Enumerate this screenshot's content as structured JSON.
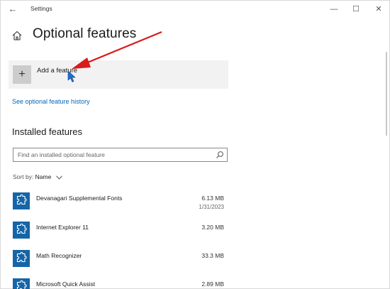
{
  "window": {
    "title": "Settings",
    "back_glyph": "←",
    "min_glyph": "—",
    "max_glyph": "☐",
    "close_glyph": "✕"
  },
  "page": {
    "title": "Optional features",
    "home_icon": "home-icon"
  },
  "add_feature": {
    "label": "Add a feature",
    "icon_glyph": "+"
  },
  "history_link": "See optional feature history",
  "installed": {
    "section_title": "Installed features",
    "search_placeholder": "Find an installed optional feature",
    "sort_label": "Sort by: ",
    "sort_value": "Name"
  },
  "features": [
    {
      "name": "Devanagari Supplemental Fonts",
      "size": "6.13 MB",
      "date": "1/31/2023"
    },
    {
      "name": "Internet Explorer 11",
      "size": "3.20 MB",
      "date": ""
    },
    {
      "name": "Math Recognizer",
      "size": "33.3 MB",
      "date": ""
    },
    {
      "name": "Microsoft Quick Assist",
      "size": "2.89 MB",
      "date": ""
    }
  ],
  "colors": {
    "accent": "#0067b8",
    "feature_icon_bg": "#1565a8",
    "annotation_arrow": "#d81b1b"
  }
}
